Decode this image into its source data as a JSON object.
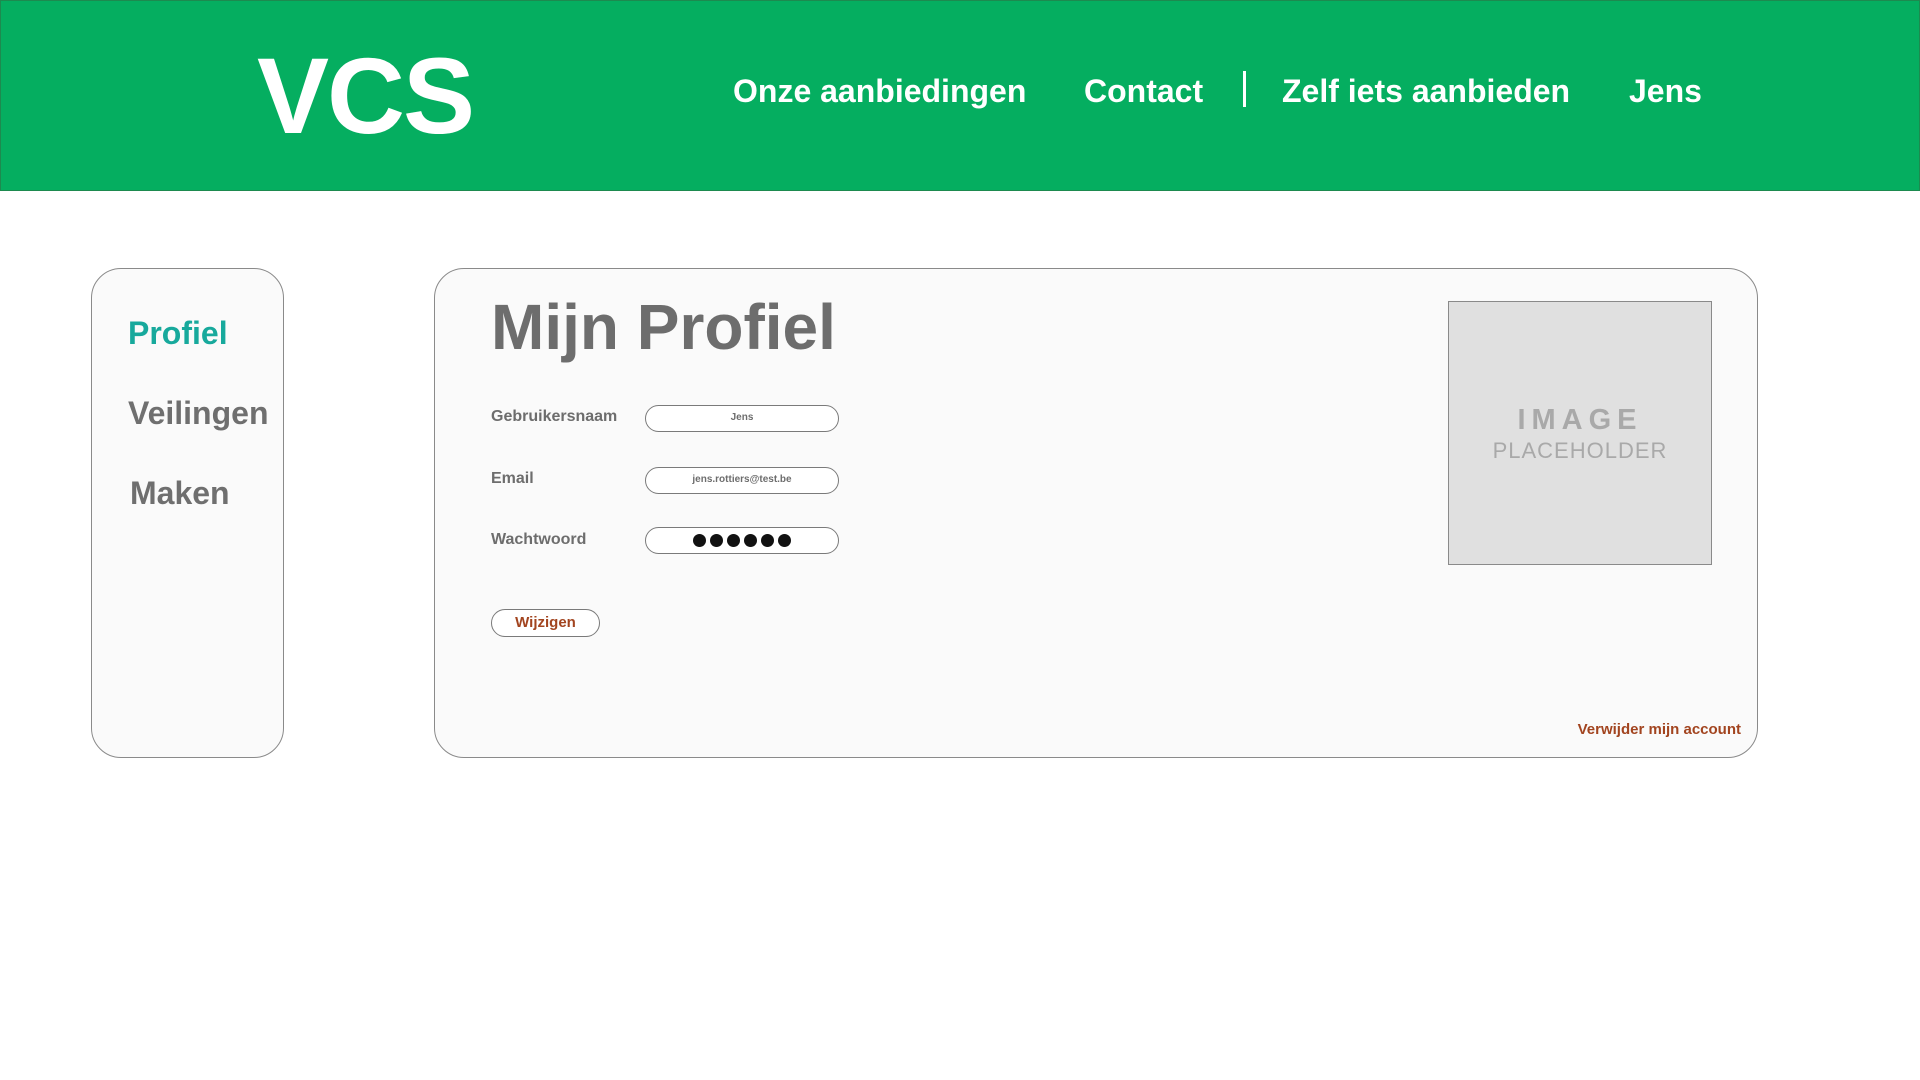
{
  "brand": {
    "logo": "VCS"
  },
  "nav": {
    "items": [
      {
        "label": "Onze aanbiedingen"
      },
      {
        "label": "Contact"
      },
      {
        "label": "Zelf iets aanbieden"
      },
      {
        "label": "Jens"
      }
    ]
  },
  "sidebar": {
    "items": [
      {
        "label": "Profiel",
        "active": true
      },
      {
        "label": "Veilingen",
        "active": false
      },
      {
        "label": "Maken",
        "active": false
      }
    ]
  },
  "profile": {
    "title": "Mijn Profiel",
    "fields": {
      "username": {
        "label": "Gebruikersnaam",
        "value": "Jens"
      },
      "email": {
        "label": "Email",
        "value": "jens.rottiers@test.be"
      },
      "password": {
        "label": "Wachtwoord",
        "masked_length": 6
      }
    },
    "edit_button": "Wijzigen",
    "image_placeholder": {
      "line1": "IMAGE",
      "line2": "PLACEHOLDER"
    },
    "delete_link": "Verwijder mijn account"
  },
  "colors": {
    "header_bg": "#05ae60",
    "active_sidebar": "#17a99c",
    "text_gray": "#6d6d6d",
    "action_red": "#a2441f"
  }
}
